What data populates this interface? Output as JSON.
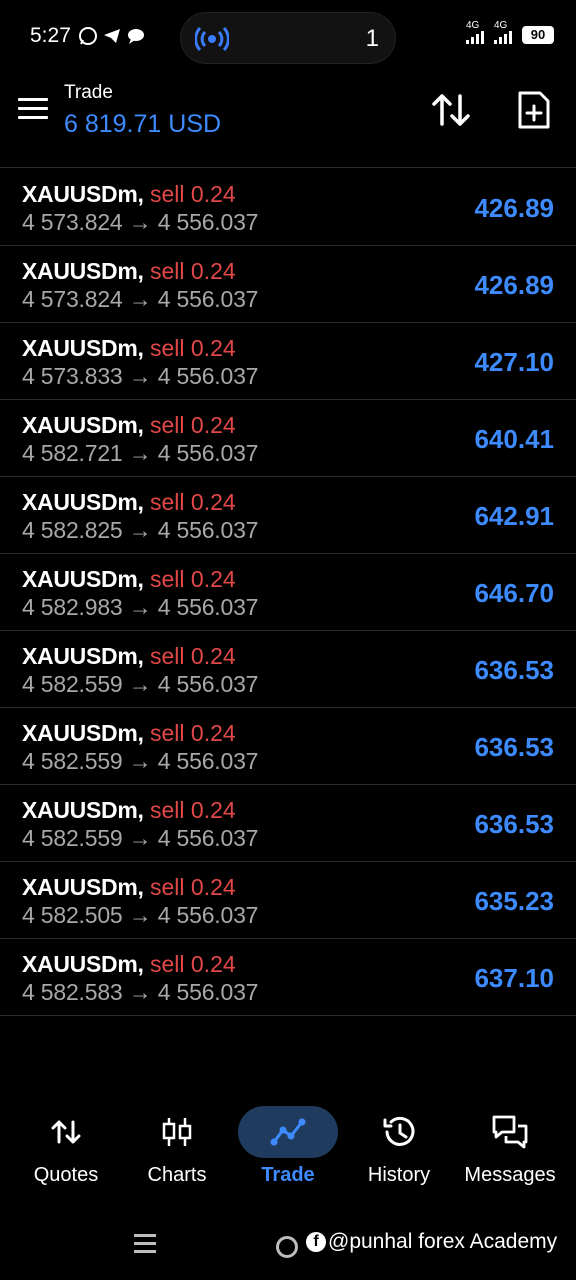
{
  "status_bar": {
    "time": "5:27",
    "notification_count": "1",
    "network1": "4G",
    "network2": "4G",
    "battery": "90"
  },
  "header": {
    "title": "Trade",
    "balance": "6 819.71 USD"
  },
  "trades": [
    {
      "symbol": "XAUUSDm,",
      "side": "sell 0.24",
      "open": "4 573.824",
      "current": "4 556.037",
      "profit": "426.89"
    },
    {
      "symbol": "XAUUSDm,",
      "side": "sell 0.24",
      "open": "4 573.824",
      "current": "4 556.037",
      "profit": "426.89"
    },
    {
      "symbol": "XAUUSDm,",
      "side": "sell 0.24",
      "open": "4 573.833",
      "current": "4 556.037",
      "profit": "427.10"
    },
    {
      "symbol": "XAUUSDm,",
      "side": "sell 0.24",
      "open": "4 582.721",
      "current": "4 556.037",
      "profit": "640.41"
    },
    {
      "symbol": "XAUUSDm,",
      "side": "sell 0.24",
      "open": "4 582.825",
      "current": "4 556.037",
      "profit": "642.91"
    },
    {
      "symbol": "XAUUSDm,",
      "side": "sell 0.24",
      "open": "4 582.983",
      "current": "4 556.037",
      "profit": "646.70"
    },
    {
      "symbol": "XAUUSDm,",
      "side": "sell 0.24",
      "open": "4 582.559",
      "current": "4 556.037",
      "profit": "636.53"
    },
    {
      "symbol": "XAUUSDm,",
      "side": "sell 0.24",
      "open": "4 582.559",
      "current": "4 556.037",
      "profit": "636.53"
    },
    {
      "symbol": "XAUUSDm,",
      "side": "sell 0.24",
      "open": "4 582.559",
      "current": "4 556.037",
      "profit": "636.53"
    },
    {
      "symbol": "XAUUSDm,",
      "side": "sell 0.24",
      "open": "4 582.505",
      "current": "4 556.037",
      "profit": "635.23"
    },
    {
      "symbol": "XAUUSDm,",
      "side": "sell 0.24",
      "open": "4 582.583",
      "current": "4 556.037",
      "profit": "637.10"
    }
  ],
  "price_arrow": "→",
  "nav": {
    "items": [
      {
        "label": "Quotes",
        "icon": "quotes-icon"
      },
      {
        "label": "Charts",
        "icon": "charts-icon"
      },
      {
        "label": "Trade",
        "icon": "trade-icon",
        "active": true
      },
      {
        "label": "History",
        "icon": "history-icon"
      },
      {
        "label": "Messages",
        "icon": "messages-icon"
      }
    ]
  },
  "watermark": "@punhal forex Academy",
  "colors": {
    "accent": "#3d8bff",
    "sell": "#e34848",
    "background": "#000000"
  }
}
